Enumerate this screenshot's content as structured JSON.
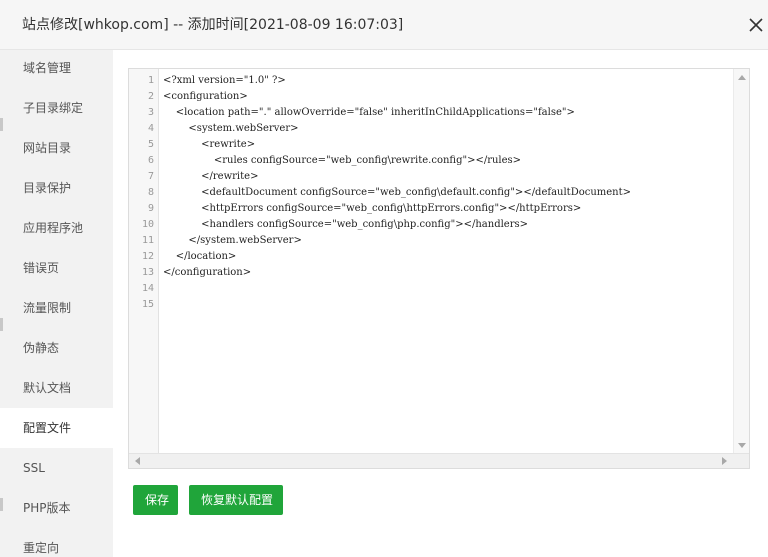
{
  "dialog": {
    "title": "站点修改[whkop.com] -- 添加时间[2021-08-09 16:07:03]"
  },
  "sidebar": {
    "items": [
      {
        "label": "域名管理"
      },
      {
        "label": "子目录绑定"
      },
      {
        "label": "网站目录"
      },
      {
        "label": "目录保护"
      },
      {
        "label": "应用程序池"
      },
      {
        "label": "错误页"
      },
      {
        "label": "流量限制"
      },
      {
        "label": "伪静态"
      },
      {
        "label": "默认文档"
      },
      {
        "label": "配置文件"
      },
      {
        "label": "SSL"
      },
      {
        "label": "PHP版本"
      },
      {
        "label": "重定向"
      }
    ],
    "active_index": 9
  },
  "editor": {
    "line_numbers": [
      "1",
      "2",
      "3",
      "4",
      "5",
      "6",
      "7",
      "8",
      "9",
      "10",
      "11",
      "12",
      "13",
      "14",
      "15"
    ],
    "lines": [
      "<?xml version=\"1.0\" ?>",
      "<configuration>",
      "    <location path=\".\" allowOverride=\"false\" inheritInChildApplications=\"false\">",
      "        <system.webServer>",
      "            <rewrite>",
      "                <rules configSource=\"web_config\\rewrite.config\"></rules>",
      "            </rewrite>",
      "            <defaultDocument configSource=\"web_config\\default.config\"></defaultDocument>",
      "            <httpErrors configSource=\"web_config\\httpErrors.config\"></httpErrors>",
      "            <handlers configSource=\"web_config\\php.config\"></handlers>",
      "        </system.webServer>",
      "    </location>",
      "</configuration>",
      "",
      ""
    ]
  },
  "buttons": {
    "save": "保存",
    "restore": "恢复默认配置"
  },
  "colors": {
    "primary": "#20a53a",
    "sidebar_bg": "#f2f2f2",
    "titlebar_bg": "#f6f6f6"
  }
}
